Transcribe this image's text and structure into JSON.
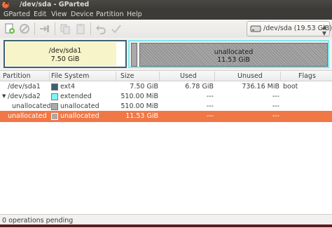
{
  "window": {
    "title": "/dev/sda - GParted"
  },
  "menu": [
    "GParted",
    "Edit",
    "View",
    "Device",
    "Partition",
    "Help"
  ],
  "device_selector": {
    "value": "/dev/sda  (19.53 GiB)"
  },
  "diskmap": {
    "partition": {
      "name": "/dev/sda1",
      "size": "7.50 GiB"
    },
    "unallocated": {
      "name": "unallocated",
      "size": "11.53 GiB"
    }
  },
  "table": {
    "headers": [
      "Partition",
      "File System",
      "Size",
      "Used",
      "Unused",
      "Flags"
    ],
    "rows": [
      {
        "partition": "/dev/sda1",
        "fs": "ext4",
        "fs_color": "#3e5f73",
        "size": "7.50 GiB",
        "used": "6.78 GiB",
        "unused": "736.16 MiB",
        "flags": "boot"
      },
      {
        "partition": "/dev/sda2",
        "fs": "extended",
        "fs_color": "#7ff5f5",
        "size": "510.00 MiB",
        "used": "---",
        "unused": "---",
        "flags": ""
      },
      {
        "partition": "unallocated",
        "fs": "unallocated",
        "fs_color": "#a9a9a9",
        "size": "510.00 MiB",
        "used": "---",
        "unused": "---",
        "flags": ""
      },
      {
        "partition": "unallocated",
        "fs": "unallocated",
        "fs_color": "#a9a9a9",
        "size": "11.53 GiB",
        "used": "---",
        "unused": "---",
        "flags": ""
      }
    ]
  },
  "status": "0 operations pending",
  "colors": {
    "selection": "#f07746",
    "ext4": "#3e5f73",
    "extended": "#7ff5f5",
    "unallocated": "#a9a9a9"
  }
}
